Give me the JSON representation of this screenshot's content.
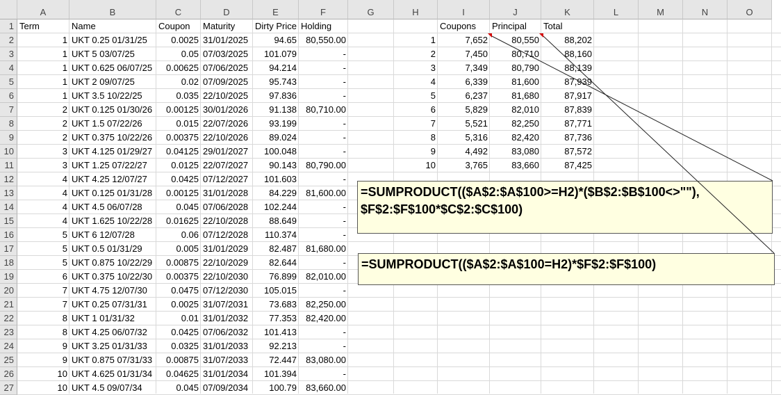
{
  "columns": [
    "A",
    "B",
    "C",
    "D",
    "E",
    "F",
    "G",
    "H",
    "I",
    "J",
    "K",
    "L",
    "M",
    "N",
    "O"
  ],
  "rows": [
    "1",
    "2",
    "3",
    "4",
    "5",
    "6",
    "7",
    "8",
    "9",
    "10",
    "11",
    "12",
    "13",
    "14",
    "15",
    "16",
    "17",
    "18",
    "19",
    "20",
    "21",
    "22",
    "23",
    "24",
    "25",
    "26",
    "27"
  ],
  "left_headers": [
    "Term",
    "Name",
    "Coupon",
    "Maturity",
    "Dirty Price",
    "Holding"
  ],
  "left_table": [
    [
      "1",
      "UKT 0.25 01/31/25",
      "0.0025",
      "31/01/2025",
      "94.65",
      "80,550.00"
    ],
    [
      "1",
      "UKT 5 03/07/25",
      "0.05",
      "07/03/2025",
      "101.079",
      "-"
    ],
    [
      "1",
      "UKT 0.625 06/07/25",
      "0.00625",
      "07/06/2025",
      "94.214",
      "-"
    ],
    [
      "1",
      "UKT 2 09/07/25",
      "0.02",
      "07/09/2025",
      "95.743",
      "-"
    ],
    [
      "1",
      "UKT 3.5 10/22/25",
      "0.035",
      "22/10/2025",
      "97.836",
      "-"
    ],
    [
      "2",
      "UKT 0.125 01/30/26",
      "0.00125",
      "30/01/2026",
      "91.138",
      "80,710.00"
    ],
    [
      "2",
      "UKT 1.5 07/22/26",
      "0.015",
      "22/07/2026",
      "93.199",
      "-"
    ],
    [
      "2",
      "UKT 0.375 10/22/26",
      "0.00375",
      "22/10/2026",
      "89.024",
      "-"
    ],
    [
      "3",
      "UKT 4.125 01/29/27",
      "0.04125",
      "29/01/2027",
      "100.048",
      "-"
    ],
    [
      "3",
      "UKT 1.25 07/22/27",
      "0.0125",
      "22/07/2027",
      "90.143",
      "80,790.00"
    ],
    [
      "4",
      "UKT 4.25 12/07/27",
      "0.0425",
      "07/12/2027",
      "101.603",
      "-"
    ],
    [
      "4",
      "UKT 0.125 01/31/28",
      "0.00125",
      "31/01/2028",
      "84.229",
      "81,600.00"
    ],
    [
      "4",
      "UKT 4.5 06/07/28",
      "0.045",
      "07/06/2028",
      "102.244",
      "-"
    ],
    [
      "4",
      "UKT 1.625 10/22/28",
      "0.01625",
      "22/10/2028",
      "88.649",
      "-"
    ],
    [
      "5",
      "UKT 6 12/07/28",
      "0.06",
      "07/12/2028",
      "110.374",
      "-"
    ],
    [
      "5",
      "UKT 0.5 01/31/29",
      "0.005",
      "31/01/2029",
      "82.487",
      "81,680.00"
    ],
    [
      "5",
      "UKT 0.875 10/22/29",
      "0.00875",
      "22/10/2029",
      "82.644",
      "-"
    ],
    [
      "6",
      "UKT 0.375 10/22/30",
      "0.00375",
      "22/10/2030",
      "76.899",
      "82,010.00"
    ],
    [
      "7",
      "UKT 4.75 12/07/30",
      "0.0475",
      "07/12/2030",
      "105.015",
      "-"
    ],
    [
      "7",
      "UKT 0.25 07/31/31",
      "0.0025",
      "31/07/2031",
      "73.683",
      "82,250.00"
    ],
    [
      "8",
      "UKT 1 01/31/32",
      "0.01",
      "31/01/2032",
      "77.353",
      "82,420.00"
    ],
    [
      "8",
      "UKT 4.25 06/07/32",
      "0.0425",
      "07/06/2032",
      "101.413",
      "-"
    ],
    [
      "9",
      "UKT 3.25 01/31/33",
      "0.0325",
      "31/01/2033",
      "92.213",
      "-"
    ],
    [
      "9",
      "UKT 0.875 07/31/33",
      "0.00875",
      "31/07/2033",
      "72.447",
      "83,080.00"
    ],
    [
      "10",
      "UKT 4.625 01/31/34",
      "0.04625",
      "31/01/2034",
      "101.394",
      "-"
    ],
    [
      "10",
      "UKT 4.5 09/07/34",
      "0.045",
      "07/09/2034",
      "100.79",
      "83,660.00"
    ]
  ],
  "right_headers": [
    "Coupons",
    "Principal",
    "Total"
  ],
  "right_table": [
    [
      "1",
      "7,652",
      "80,550",
      "88,202"
    ],
    [
      "2",
      "7,450",
      "80,710",
      "88,160"
    ],
    [
      "3",
      "7,349",
      "80,790",
      "88,139"
    ],
    [
      "4",
      "6,339",
      "81,600",
      "87,939"
    ],
    [
      "5",
      "6,237",
      "81,680",
      "87,917"
    ],
    [
      "6",
      "5,829",
      "82,010",
      "87,839"
    ],
    [
      "7",
      "5,521",
      "82,250",
      "87,771"
    ],
    [
      "8",
      "5,316",
      "82,420",
      "87,736"
    ],
    [
      "9",
      "4,492",
      "83,080",
      "87,572"
    ],
    [
      "10",
      "3,765",
      "83,660",
      "87,425"
    ]
  ],
  "callouts": {
    "coupons_formula": "=SUMPRODUCT(($A$2:$A$100>=H2)*($B$2:$B$100<>\"\"),\n$F$2:$F$100*$C$2:$C$100)",
    "principal_formula": "=SUMPRODUCT(($A$2:$A$100=H2)*$F$2:$F$100)"
  },
  "colors": {
    "comment_marker": "#d40000",
    "callout_bg": "#ffffe1",
    "header_bg": "#e6e6e6"
  }
}
